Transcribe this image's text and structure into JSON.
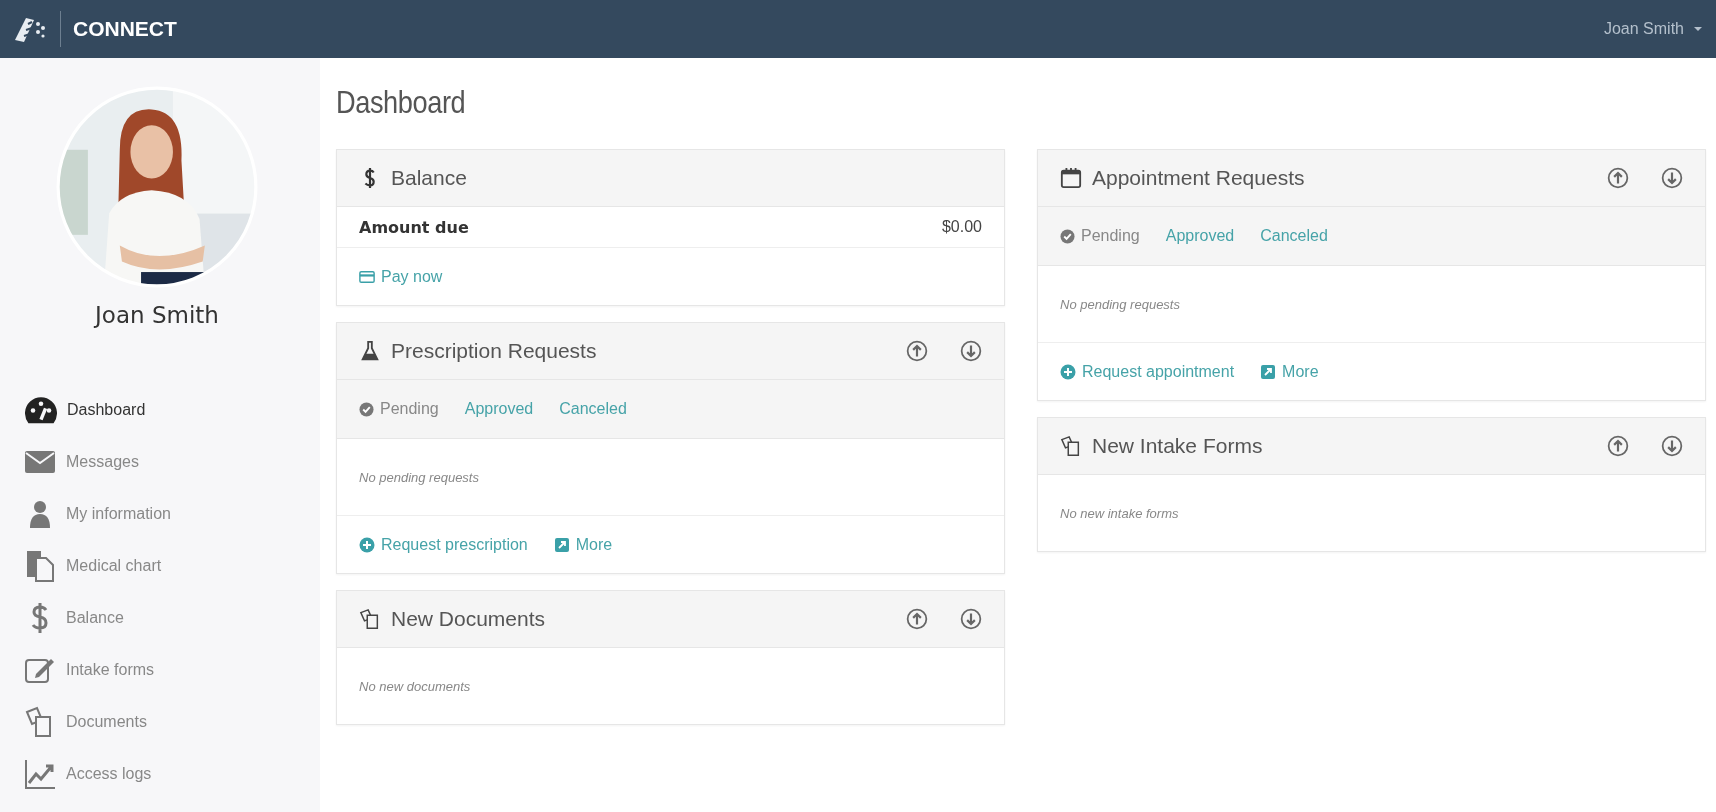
{
  "header": {
    "brand": "CONNECT",
    "user": "Joan Smith"
  },
  "profile": {
    "name": "Joan Smith"
  },
  "nav": [
    {
      "label": "Dashboard",
      "selected": true
    },
    {
      "label": "Messages",
      "selected": false
    },
    {
      "label": "My information",
      "selected": false
    },
    {
      "label": "Medical chart",
      "selected": false
    },
    {
      "label": "Balance",
      "selected": false
    },
    {
      "label": "Intake forms",
      "selected": false
    },
    {
      "label": "Documents",
      "selected": false
    },
    {
      "label": "Access logs",
      "selected": false
    }
  ],
  "page_title": "Dashboard",
  "columns": [
    [
      {
        "kind": "balance",
        "title": "Balance",
        "reorder": false,
        "amount_label": "Amount due",
        "amount": "$0.00",
        "actions": [
          {
            "kind": "pay",
            "label": "Pay now"
          }
        ]
      },
      {
        "kind": "requests",
        "title": "Prescription Requests",
        "reorder": true,
        "tabs": [
          {
            "label": "Pending",
            "selected": true
          },
          {
            "label": "Approved",
            "selected": false
          },
          {
            "label": "Canceled",
            "selected": false
          }
        ],
        "empty": "No pending requests",
        "actions": [
          {
            "kind": "add",
            "label": "Request prescription"
          },
          {
            "kind": "more",
            "label": "More"
          }
        ]
      },
      {
        "kind": "list",
        "title": "New Documents",
        "reorder": true,
        "empty": "No new documents"
      }
    ],
    [
      {
        "kind": "requests",
        "title": "Appointment Requests",
        "reorder": true,
        "tabs": [
          {
            "label": "Pending",
            "selected": true
          },
          {
            "label": "Approved",
            "selected": false
          },
          {
            "label": "Canceled",
            "selected": false
          }
        ],
        "empty": "No pending requests",
        "actions": [
          {
            "kind": "add",
            "label": "Request appointment"
          },
          {
            "kind": "more",
            "label": "More"
          }
        ]
      },
      {
        "kind": "list",
        "title": "New Intake Forms",
        "reorder": true,
        "empty": "No new intake forms"
      }
    ]
  ]
}
